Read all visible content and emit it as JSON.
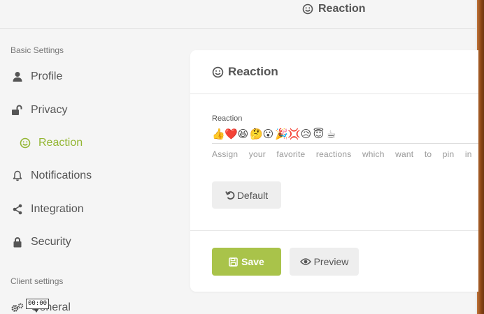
{
  "header": {
    "title": "Reaction",
    "icon": "smile-icon"
  },
  "sidebar": {
    "section_basic": "Basic Settings",
    "section_client": "Client settings",
    "items": [
      {
        "label": "Profile",
        "icon": "user-icon"
      },
      {
        "label": "Privacy",
        "icon": "unlock-icon"
      },
      {
        "label": "Reaction",
        "icon": "smile-icon",
        "active": true
      },
      {
        "label": "Notifications",
        "icon": "bell-icon"
      },
      {
        "label": "Integration",
        "icon": "share-icon"
      },
      {
        "label": "Security",
        "icon": "lock-icon"
      },
      {
        "label": "General",
        "icon": "gears-icon"
      }
    ]
  },
  "card": {
    "title": "Reaction",
    "field_label": "Reaction",
    "emojis": [
      "👍",
      "❤️",
      "😆",
      "🤔",
      "😮",
      "🎉",
      "💢",
      "😥",
      "😇",
      "☕"
    ],
    "helper_text": "Assign your favorite reactions which want to pin in",
    "default_label": "Default",
    "save_label": "Save",
    "preview_label": "Preview"
  },
  "tooltip": {
    "text": "00:00"
  },
  "colors": {
    "accent": "#93b633",
    "save_bg": "#a9c34a"
  }
}
